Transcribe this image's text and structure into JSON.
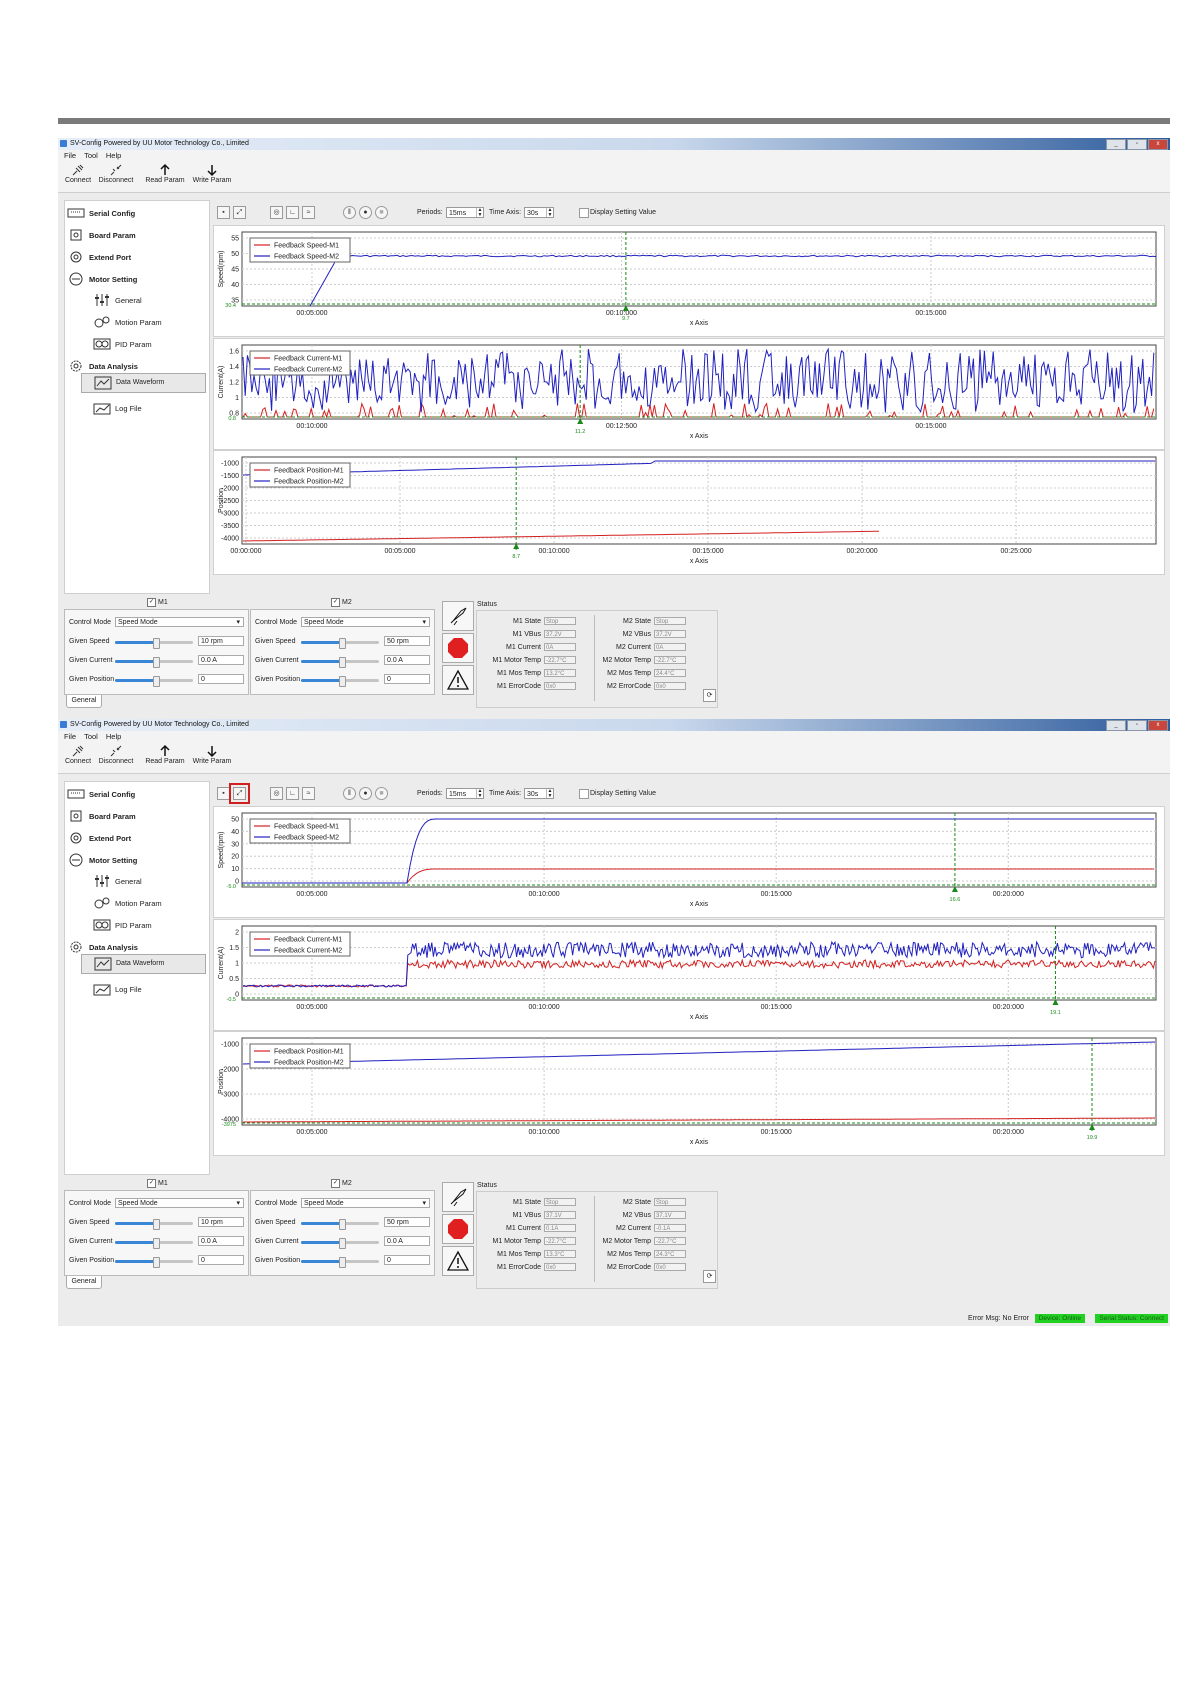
{
  "app": {
    "title": "SV-Config Powered by UU Motor Technology Co., Limited",
    "menu": [
      "File",
      "Tool",
      "Help"
    ],
    "toolbar": [
      "Connect",
      "Disconnect",
      "Read Param",
      "Write Param"
    ],
    "window_buttons": [
      "_",
      "▫",
      "x"
    ]
  },
  "nav": {
    "serial": "Serial Config",
    "board": "Board Param",
    "extend": "Extend Port",
    "motor": "Motor Setting",
    "general": "General",
    "motion": "Motion Param",
    "pid": "PID Param",
    "analysis": "Data Analysis",
    "waveform": "Data Waveform",
    "logfile": "Log File"
  },
  "controls": {
    "periods_label": "Periods:",
    "periods_value": "15ms",
    "timeaxis_label": "Time Axis:",
    "timeaxis_value": "30s",
    "display_setting": "Display Setting Value"
  },
  "motor_panel": {
    "m1": "M1",
    "m2": "M2",
    "control_mode_label": "Control Mode",
    "control_mode_value": "Speed Mode",
    "given_speed": "Given Speed",
    "given_current": "Given Current",
    "given_position": "Given Position",
    "m1_speed": "10 rpm",
    "m2_speed": "50 rpm",
    "current_value": "0.0 A",
    "position_value": "0",
    "tab": "General"
  },
  "status": {
    "title": "Status",
    "m1_labels": [
      "M1 State",
      "M1 VBus",
      "M1 Current",
      "M1 Motor Temp",
      "M1 Mos Temp",
      "M1 ErrorCode"
    ],
    "m2_labels": [
      "M2 State",
      "M2 VBus",
      "M2 Current",
      "M2 Motor Temp",
      "M2 Mos Temp",
      "M2 ErrorCode"
    ],
    "shot1_m1": [
      "Stop",
      "37.2V",
      "0A",
      "-22.7°C",
      "13.2°C",
      "0x0"
    ],
    "shot1_m2": [
      "Stop",
      "37.2V",
      "0A",
      "-22.7°C",
      "24.4°C",
      "0x0"
    ],
    "shot2_m1": [
      "Stop",
      "37.1V",
      "0.1A",
      "-22.7°C",
      "13.3°C",
      "0x0"
    ],
    "shot2_m2": [
      "Stop",
      "37.1V",
      "-0.1A",
      "-22.7°C",
      "24.3°C",
      "0x0"
    ]
  },
  "statusbar": {
    "error": "Error Msg: No Error",
    "device": "Device: Online",
    "serial": "Serial Status: Connect"
  },
  "colors": {
    "m1": "#d42020",
    "m2": "#2020c0",
    "marker": "#1a8a1a",
    "green_status": "#22d022",
    "highlight": "#d02020"
  },
  "chart_data": [
    {
      "type": "line",
      "id": "s1_speed",
      "ylabel": "Speed(rpm)",
      "xlabel": "x Axis",
      "ylim": [
        30.4,
        57
      ],
      "yticks": [
        "55",
        "50",
        "45",
        "40",
        "35"
      ],
      "xticks": [
        "00:05:000",
        "00:10:000",
        "00:15:000"
      ],
      "legend": [
        "Feedback Speed-M1",
        "Feedback Speed-M2"
      ],
      "ymin_label": "30.4",
      "marker_label": "9.7",
      "series": [
        {
          "name": "Feedback Speed-M2",
          "shape": "rise-then-flat",
          "value": 50
        }
      ]
    },
    {
      "type": "line",
      "id": "s1_current",
      "ylabel": "Current(A)",
      "xlabel": "x Axis",
      "ylim": [
        0,
        1.7
      ],
      "yticks": [
        "1.6",
        "1.4",
        "1.2",
        "1",
        "0.8"
      ],
      "xticks": [
        "00:10:000",
        "00:12:500",
        "00:15:000"
      ],
      "legend": [
        "Feedback Current-M1",
        "Feedback Current-M2"
      ],
      "ymin_label": "0.8",
      "marker_label": "11.2",
      "series": [
        {
          "name": "Feedback Current-M1",
          "shape": "spiky-low"
        },
        {
          "name": "Feedback Current-M2",
          "shape": "noisy-high"
        }
      ]
    },
    {
      "type": "line",
      "id": "s1_position",
      "ylabel": "Position",
      "xlabel": "x Axis",
      "ylim": [
        -4000,
        -1000
      ],
      "yticks": [
        "-1000",
        "-1500",
        "-2000",
        "-2500",
        "-3000",
        "-3500",
        "-4000"
      ],
      "xticks": [
        "00:00:000",
        "00:05:000",
        "00:10:000",
        "00:15:000",
        "00:20:000",
        "00:25:000"
      ],
      "legend": [
        "Feedback Position-M1",
        "Feedback Position-M2"
      ],
      "marker_label": "8.7",
      "series": [
        {
          "name": "Feedback Position-M2",
          "shape": "rising-top"
        },
        {
          "name": "Feedback Position-M1",
          "shape": "rising-bottom"
        }
      ]
    },
    {
      "type": "line",
      "id": "s2_speed",
      "ylabel": "Speed(rpm)",
      "xlabel": "x Axis",
      "ylim": [
        -5,
        55
      ],
      "yticks": [
        "50",
        "40",
        "30",
        "20",
        "10",
        "0"
      ],
      "xticks": [
        "00:05:000",
        "00:10:000",
        "00:15:000",
        "00:20:000"
      ],
      "legend": [
        "Feedback Speed-M1",
        "Feedback Speed-M2"
      ],
      "ymin_label": "-5.0",
      "marker_label": "16.6",
      "series": [
        {
          "name": "Feedback Speed-M1",
          "value": 10
        },
        {
          "name": "Feedback Speed-M2",
          "value": 50
        }
      ]
    },
    {
      "type": "line",
      "id": "s2_current",
      "ylabel": "Current(A)",
      "xlabel": "x Axis",
      "ylim": [
        -0.5,
        2.2
      ],
      "yticks": [
        "2",
        "1.5",
        "1",
        "0.5",
        "0"
      ],
      "xticks": [
        "00:05:000",
        "00:10:000",
        "00:15:000",
        "00:20:000"
      ],
      "legend": [
        "Feedback Current-M1",
        "Feedback Current-M2"
      ],
      "ymin_label": "-0.5",
      "marker_label": "19.1",
      "series": [
        {
          "name": "Feedback Current-M1",
          "shape": "noisy-mid"
        },
        {
          "name": "Feedback Current-M2",
          "shape": "noisy-high"
        }
      ]
    },
    {
      "type": "line",
      "id": "s2_position",
      "ylabel": "Position",
      "xlabel": "x Axis",
      "ylim": [
        -4000,
        -500
      ],
      "yticks": [
        "-1000",
        "-2000",
        "-3000",
        "-4000"
      ],
      "xticks": [
        "00:05:000",
        "00:10:000",
        "00:15:000",
        "00:20:000"
      ],
      "legend": [
        "Feedback Position-M1",
        "Feedback Position-M2"
      ],
      "ymin_label": "-3975",
      "marker_label": "19.9",
      "series": [
        {
          "name": "Feedback Position-M2",
          "shape": "rising-top"
        },
        {
          "name": "Feedback Position-M1",
          "shape": "rising-bottom"
        }
      ]
    }
  ]
}
